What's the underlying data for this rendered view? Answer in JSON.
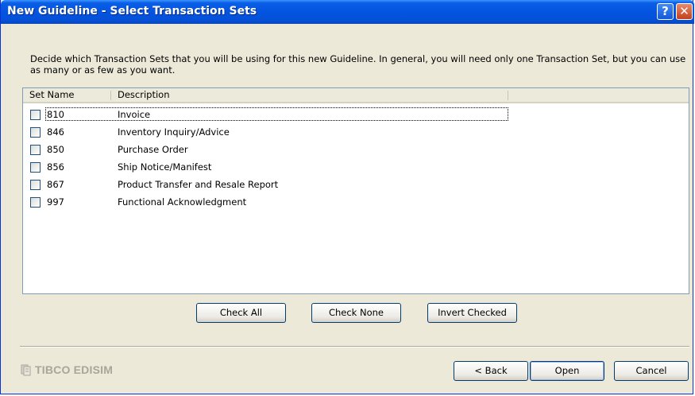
{
  "window": {
    "title": "New Guideline - Select Transaction Sets",
    "help_label": "?",
    "close_label": "✕"
  },
  "instruction": "Decide which Transaction Sets that you will be using for this new Guideline. In general, you will need only one Transaction Set, but you can use as many or as few as you want.",
  "list": {
    "columns": [
      "Set Name",
      "Description"
    ],
    "rows": [
      {
        "set": "810",
        "description": "Invoice",
        "checked": false
      },
      {
        "set": "846",
        "description": "Inventory Inquiry/Advice",
        "checked": false
      },
      {
        "set": "850",
        "description": "Purchase Order",
        "checked": false
      },
      {
        "set": "856",
        "description": "Ship Notice/Manifest",
        "checked": false
      },
      {
        "set": "867",
        "description": "Product Transfer and Resale Report",
        "checked": false
      },
      {
        "set": "997",
        "description": "Functional Acknowledgment",
        "checked": false
      }
    ]
  },
  "check_buttons": {
    "check_all": "Check All",
    "check_none": "Check None",
    "invert_checked": "Invert Checked"
  },
  "brand": {
    "name": "TIBCO EDISIM",
    "icon": "edisim-logo-icon"
  },
  "nav_buttons": {
    "back": "< Back",
    "open": "Open",
    "cancel": "Cancel"
  },
  "colors": {
    "titlebar": "#0454e0",
    "dialog_bg": "#ece9d8",
    "button_border": "#003c74"
  }
}
